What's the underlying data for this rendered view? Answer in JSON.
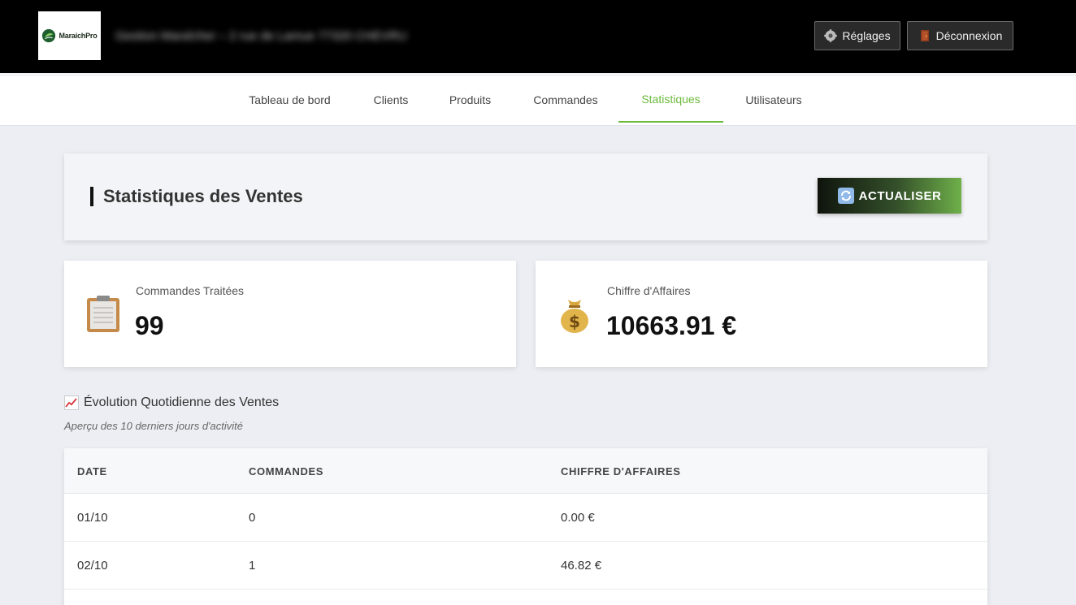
{
  "header": {
    "logo_text": "MaraichPro",
    "org_name": "Gestion Maraîcher – 2 rue de Lamue 77320 CHEVRU",
    "settings_label": "Réglages",
    "logout_label": "Déconnexion",
    "settings_icon": "gear-icon",
    "logout_icon": "door-icon"
  },
  "nav": {
    "items": [
      {
        "label": "Tableau de bord"
      },
      {
        "label": "Clients"
      },
      {
        "label": "Produits"
      },
      {
        "label": "Commandes"
      },
      {
        "label": "Statistiques",
        "active": true
      },
      {
        "label": "Utilisateurs"
      }
    ],
    "accent_color": "#6cba3c"
  },
  "page": {
    "title": "Statistiques des Ventes",
    "refresh_label": "ACTUALISER",
    "refresh_icon": "refresh-icon"
  },
  "stats": {
    "orders": {
      "label": "Commandes Traitées",
      "value": "99",
      "icon": "clipboard-icon"
    },
    "revenue": {
      "label": "Chiffre d'Affaires",
      "value": "10663.91 €",
      "icon": "money-bag-icon"
    }
  },
  "section": {
    "title": "Évolution Quotidienne des Ventes",
    "subtitle": "Aperçu des 10 derniers jours d'activité",
    "icon": "chart-increasing-icon"
  },
  "table": {
    "headers": [
      "DATE",
      "COMMANDES",
      "CHIFFRE D'AFFAIRES"
    ],
    "rows": [
      [
        "01/10",
        "0",
        "0.00 €"
      ],
      [
        "02/10",
        "1",
        "46.82 €"
      ]
    ]
  }
}
